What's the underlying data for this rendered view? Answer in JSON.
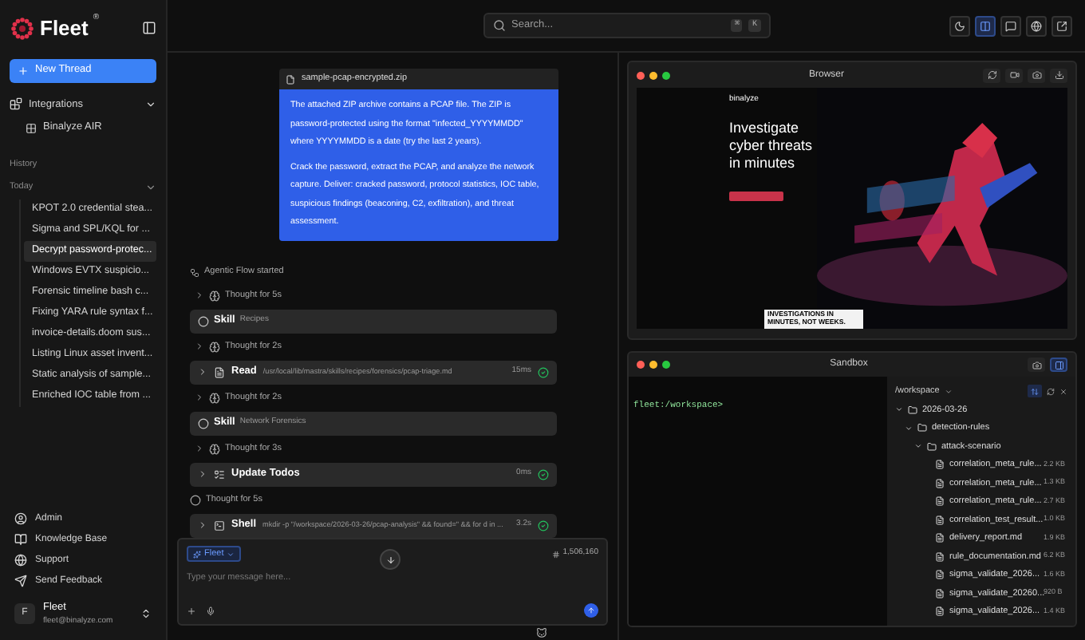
{
  "sidebar": {
    "brand": "Fleet",
    "brand_mark": "®",
    "new_thread": "New Thread",
    "integrations": {
      "label": "Integrations",
      "expanded": true,
      "items": [
        "Binalyze AIR"
      ]
    },
    "history_label": "History",
    "group": {
      "label": "Today",
      "expanded": true
    },
    "threads": [
      {
        "title": "KPOT 2.0 credential stea...",
        "selected": false
      },
      {
        "title": "Sigma and SPL/KQL for ...",
        "selected": false
      },
      {
        "title": "Decrypt password-protec...",
        "selected": true
      },
      {
        "title": "Windows EVTX suspicio...",
        "selected": false
      },
      {
        "title": "Forensic timeline bash c...",
        "selected": false
      },
      {
        "title": "Fixing YARA rule syntax f...",
        "selected": false
      },
      {
        "title": "invoice-details.doom sus...",
        "selected": false
      },
      {
        "title": "Listing Linux asset invent...",
        "selected": false
      },
      {
        "title": "Static analysis of sample...",
        "selected": false
      },
      {
        "title": "Enriched IOC table from ...",
        "selected": false
      }
    ],
    "links": [
      {
        "kind": "admin",
        "label": "Admin"
      },
      {
        "kind": "knowledge",
        "label": "Knowledge Base"
      },
      {
        "kind": "support",
        "label": "Support"
      },
      {
        "kind": "feedback",
        "label": "Send Feedback"
      }
    ],
    "user": {
      "initial": "F",
      "name": "Fleet",
      "email": "fleet@binalyze.com"
    }
  },
  "topbar": {
    "search_placeholder": "Search...",
    "shortcut": [
      "⌘",
      "K"
    ],
    "tools": [
      {
        "kind": "theme",
        "selected": false
      },
      {
        "kind": "layout",
        "selected": true
      },
      {
        "kind": "chat",
        "selected": false
      },
      {
        "kind": "browser",
        "selected": false
      },
      {
        "kind": "external",
        "selected": false
      }
    ]
  },
  "chat": {
    "attachment": "sample-pcap-encrypted.zip",
    "message": [
      "The attached ZIP archive contains a PCAP file. The ZIP is password-protected using the format \"infected_YYYYMMDD\" where YYYYMMDD is a date (try the last 2 years).",
      "Crack the password, extract the PCAP, and analyze the network capture. Deliver: cracked password, protocol statistics, IOC table, suspicious findings (beaconing, C2, exfiltration), and threat assessment."
    ],
    "steps": [
      {
        "kind": "status",
        "text": "Agentic Flow started"
      },
      {
        "kind": "thought",
        "text": "Thought for 5s",
        "expandable": true
      },
      {
        "kind": "skill",
        "name": "Skill",
        "detail": "Recipes"
      },
      {
        "kind": "thought",
        "text": "Thought for 2s",
        "expandable": true
      },
      {
        "kind": "read",
        "name": "Read",
        "detail": "/usr/local/lib/mastra/skills/recipes/forensics/pcap-triage.md",
        "duration": "15ms",
        "done": true
      },
      {
        "kind": "thought",
        "text": "Thought for 2s",
        "expandable": true
      },
      {
        "kind": "skill",
        "name": "Skill",
        "detail": "Network Forensics"
      },
      {
        "kind": "thought",
        "text": "Thought for 3s",
        "expandable": true
      },
      {
        "kind": "todos",
        "name": "Update Todos",
        "duration": "0ms",
        "done": true
      },
      {
        "kind": "thought",
        "text": "Thought for 5s",
        "expandable": false
      },
      {
        "kind": "shell",
        "name": "Shell",
        "detail": "mkdir -p \"/workspace/2026-03-26/pcap-analysis\" && found=\" && for d in ...",
        "duration": "3.2s",
        "done": true
      }
    ],
    "composer": {
      "agent": "Fleet",
      "tokens": "1,506,160",
      "placeholder": "Type your message here..."
    }
  },
  "browser": {
    "title": "Browser",
    "site": {
      "logo": "binalyze",
      "headline": "Investigate cyber threats in minutes",
      "promo": "INVESTIGATIONS IN MINUTES, NOT WEEKS."
    }
  },
  "sandbox": {
    "title": "Sandbox",
    "prompt": "fleet:/workspace>",
    "panel_open": true,
    "path": "/workspace",
    "tree": [
      {
        "kind": "folder",
        "name": "2026-03-26",
        "expanded": true,
        "children": [
          {
            "kind": "folder",
            "name": "detection-rules",
            "expanded": true,
            "children": [
              {
                "kind": "folder",
                "name": "attack-scenario",
                "expanded": true,
                "children": [
                  {
                    "kind": "file",
                    "name": "correlation_meta_rule...",
                    "size": "2.2 KB"
                  },
                  {
                    "kind": "file",
                    "name": "correlation_meta_rule...",
                    "size": "1.3 KB"
                  },
                  {
                    "kind": "file",
                    "name": "correlation_meta_rule...",
                    "size": "2.7 KB"
                  },
                  {
                    "kind": "file",
                    "name": "correlation_test_result...",
                    "size": "1.0 KB"
                  },
                  {
                    "kind": "file",
                    "name": "delivery_report.md",
                    "size": "1.9 KB"
                  },
                  {
                    "kind": "file",
                    "name": "rule_documentation.md",
                    "size": "6.2 KB"
                  },
                  {
                    "kind": "file",
                    "name": "sigma_validate_2026...",
                    "size": "1.6 KB"
                  },
                  {
                    "kind": "file",
                    "name": "sigma_validate_20260...",
                    "size": "920 B"
                  },
                  {
                    "kind": "file",
                    "name": "sigma_validate_2026...",
                    "size": "1.4 KB"
                  }
                ]
              }
            ]
          }
        ]
      }
    ]
  }
}
